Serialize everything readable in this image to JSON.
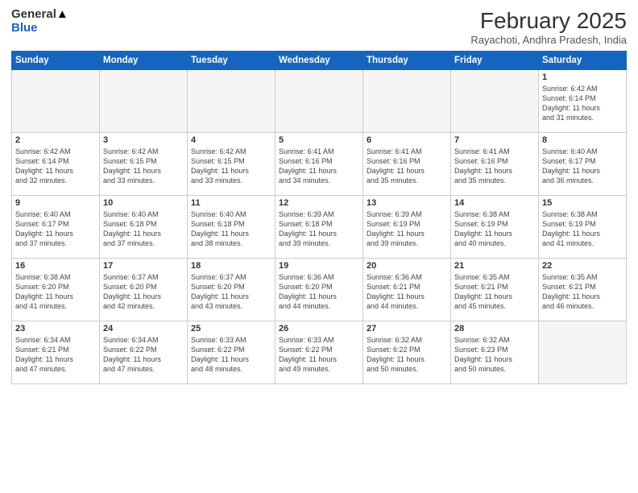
{
  "header": {
    "logo_general": "General",
    "logo_blue": "Blue",
    "title": "February 2025",
    "subtitle": "Rayachoti, Andhra Pradesh, India"
  },
  "days_of_week": [
    "Sunday",
    "Monday",
    "Tuesday",
    "Wednesday",
    "Thursday",
    "Friday",
    "Saturday"
  ],
  "weeks": [
    [
      {
        "day": "",
        "info": ""
      },
      {
        "day": "",
        "info": ""
      },
      {
        "day": "",
        "info": ""
      },
      {
        "day": "",
        "info": ""
      },
      {
        "day": "",
        "info": ""
      },
      {
        "day": "",
        "info": ""
      },
      {
        "day": "1",
        "info": "Sunrise: 6:42 AM\nSunset: 6:14 PM\nDaylight: 11 hours\nand 31 minutes."
      }
    ],
    [
      {
        "day": "2",
        "info": "Sunrise: 6:42 AM\nSunset: 6:14 PM\nDaylight: 11 hours\nand 32 minutes."
      },
      {
        "day": "3",
        "info": "Sunrise: 6:42 AM\nSunset: 6:15 PM\nDaylight: 11 hours\nand 33 minutes."
      },
      {
        "day": "4",
        "info": "Sunrise: 6:42 AM\nSunset: 6:15 PM\nDaylight: 11 hours\nand 33 minutes."
      },
      {
        "day": "5",
        "info": "Sunrise: 6:41 AM\nSunset: 6:16 PM\nDaylight: 11 hours\nand 34 minutes."
      },
      {
        "day": "6",
        "info": "Sunrise: 6:41 AM\nSunset: 6:16 PM\nDaylight: 11 hours\nand 35 minutes."
      },
      {
        "day": "7",
        "info": "Sunrise: 6:41 AM\nSunset: 6:16 PM\nDaylight: 11 hours\nand 35 minutes."
      },
      {
        "day": "8",
        "info": "Sunrise: 6:40 AM\nSunset: 6:17 PM\nDaylight: 11 hours\nand 36 minutes."
      }
    ],
    [
      {
        "day": "9",
        "info": "Sunrise: 6:40 AM\nSunset: 6:17 PM\nDaylight: 11 hours\nand 37 minutes."
      },
      {
        "day": "10",
        "info": "Sunrise: 6:40 AM\nSunset: 6:18 PM\nDaylight: 11 hours\nand 37 minutes."
      },
      {
        "day": "11",
        "info": "Sunrise: 6:40 AM\nSunset: 6:18 PM\nDaylight: 11 hours\nand 38 minutes."
      },
      {
        "day": "12",
        "info": "Sunrise: 6:39 AM\nSunset: 6:18 PM\nDaylight: 11 hours\nand 39 minutes."
      },
      {
        "day": "13",
        "info": "Sunrise: 6:39 AM\nSunset: 6:19 PM\nDaylight: 11 hours\nand 39 minutes."
      },
      {
        "day": "14",
        "info": "Sunrise: 6:38 AM\nSunset: 6:19 PM\nDaylight: 11 hours\nand 40 minutes."
      },
      {
        "day": "15",
        "info": "Sunrise: 6:38 AM\nSunset: 6:19 PM\nDaylight: 11 hours\nand 41 minutes."
      }
    ],
    [
      {
        "day": "16",
        "info": "Sunrise: 6:38 AM\nSunset: 6:20 PM\nDaylight: 11 hours\nand 41 minutes."
      },
      {
        "day": "17",
        "info": "Sunrise: 6:37 AM\nSunset: 6:20 PM\nDaylight: 11 hours\nand 42 minutes."
      },
      {
        "day": "18",
        "info": "Sunrise: 6:37 AM\nSunset: 6:20 PM\nDaylight: 11 hours\nand 43 minutes."
      },
      {
        "day": "19",
        "info": "Sunrise: 6:36 AM\nSunset: 6:20 PM\nDaylight: 11 hours\nand 44 minutes."
      },
      {
        "day": "20",
        "info": "Sunrise: 6:36 AM\nSunset: 6:21 PM\nDaylight: 11 hours\nand 44 minutes."
      },
      {
        "day": "21",
        "info": "Sunrise: 6:35 AM\nSunset: 6:21 PM\nDaylight: 11 hours\nand 45 minutes."
      },
      {
        "day": "22",
        "info": "Sunrise: 6:35 AM\nSunset: 6:21 PM\nDaylight: 11 hours\nand 46 minutes."
      }
    ],
    [
      {
        "day": "23",
        "info": "Sunrise: 6:34 AM\nSunset: 6:21 PM\nDaylight: 11 hours\nand 47 minutes."
      },
      {
        "day": "24",
        "info": "Sunrise: 6:34 AM\nSunset: 6:22 PM\nDaylight: 11 hours\nand 47 minutes."
      },
      {
        "day": "25",
        "info": "Sunrise: 6:33 AM\nSunset: 6:22 PM\nDaylight: 11 hours\nand 48 minutes."
      },
      {
        "day": "26",
        "info": "Sunrise: 6:33 AM\nSunset: 6:22 PM\nDaylight: 11 hours\nand 49 minutes."
      },
      {
        "day": "27",
        "info": "Sunrise: 6:32 AM\nSunset: 6:22 PM\nDaylight: 11 hours\nand 50 minutes."
      },
      {
        "day": "28",
        "info": "Sunrise: 6:32 AM\nSunset: 6:23 PM\nDaylight: 11 hours\nand 50 minutes."
      },
      {
        "day": "",
        "info": ""
      }
    ]
  ]
}
